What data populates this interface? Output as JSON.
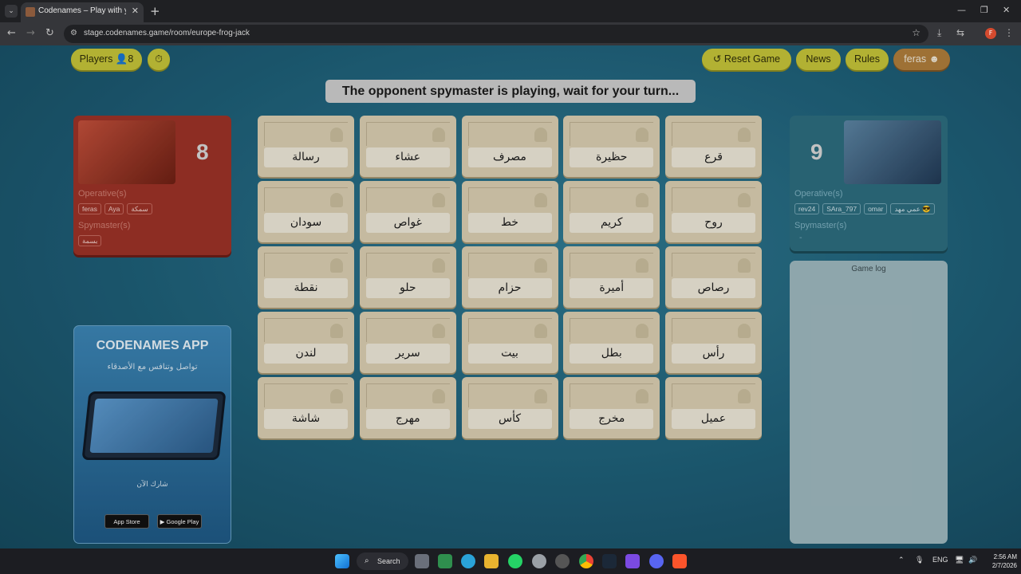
{
  "browser": {
    "tab_title": "Codenames – Play with your Fri",
    "url": "stage.codenames.game/room/europe-frog-jack",
    "profile_initial": "F"
  },
  "top_bar": {
    "players_label": "Players",
    "players_count": "8",
    "reset_label": "Reset Game",
    "news_label": "News",
    "rules_label": "Rules",
    "user_label": "feras"
  },
  "banner": "The opponent spymaster is playing, wait for your turn...",
  "red_team": {
    "score": "8",
    "operatives_label": "Operative(s)",
    "operatives": [
      "feras",
      "Aya",
      "سمكة"
    ],
    "spymasters_label": "Spymaster(s)",
    "spymasters": [
      "بسمة"
    ]
  },
  "blue_team": {
    "score": "9",
    "operatives_label": "Operative(s)",
    "operatives": [
      "rev24",
      "SAra_797",
      "omar",
      "عمي مهد 😎"
    ],
    "spymasters_label": "Spymaster(s)",
    "spymasters_placeholder": "-"
  },
  "cards": [
    "رسالة",
    "عشاء",
    "مصرف",
    "حظيرة",
    "قرع",
    "سودان",
    "غواص",
    "خط",
    "كريم",
    "روح",
    "نقطة",
    "حلو",
    "حزام",
    "أميرة",
    "رصاص",
    "لندن",
    "سرير",
    "بيت",
    "بطل",
    "رأس",
    "شاشة",
    "مهرج",
    "كأس",
    "مخرج",
    "عميل"
  ],
  "app_ad": {
    "title": "CODENAMES APP",
    "subtitle": "تواصل وتنافس مع الأصدقاء",
    "cta": "شارك الآن",
    "app_store": "App Store",
    "google_play": "Google Play"
  },
  "game_log": {
    "title": "Game log"
  },
  "taskbar": {
    "search_label": "Search",
    "language": "ENG",
    "time": "2:56 AM",
    "date": "2/7/2026"
  },
  "colors": {
    "accent_yellow": "#c7c639",
    "red_team": "#9e3328",
    "blue_team": "#2d6e7f",
    "board_bg": "#1e5f78"
  }
}
